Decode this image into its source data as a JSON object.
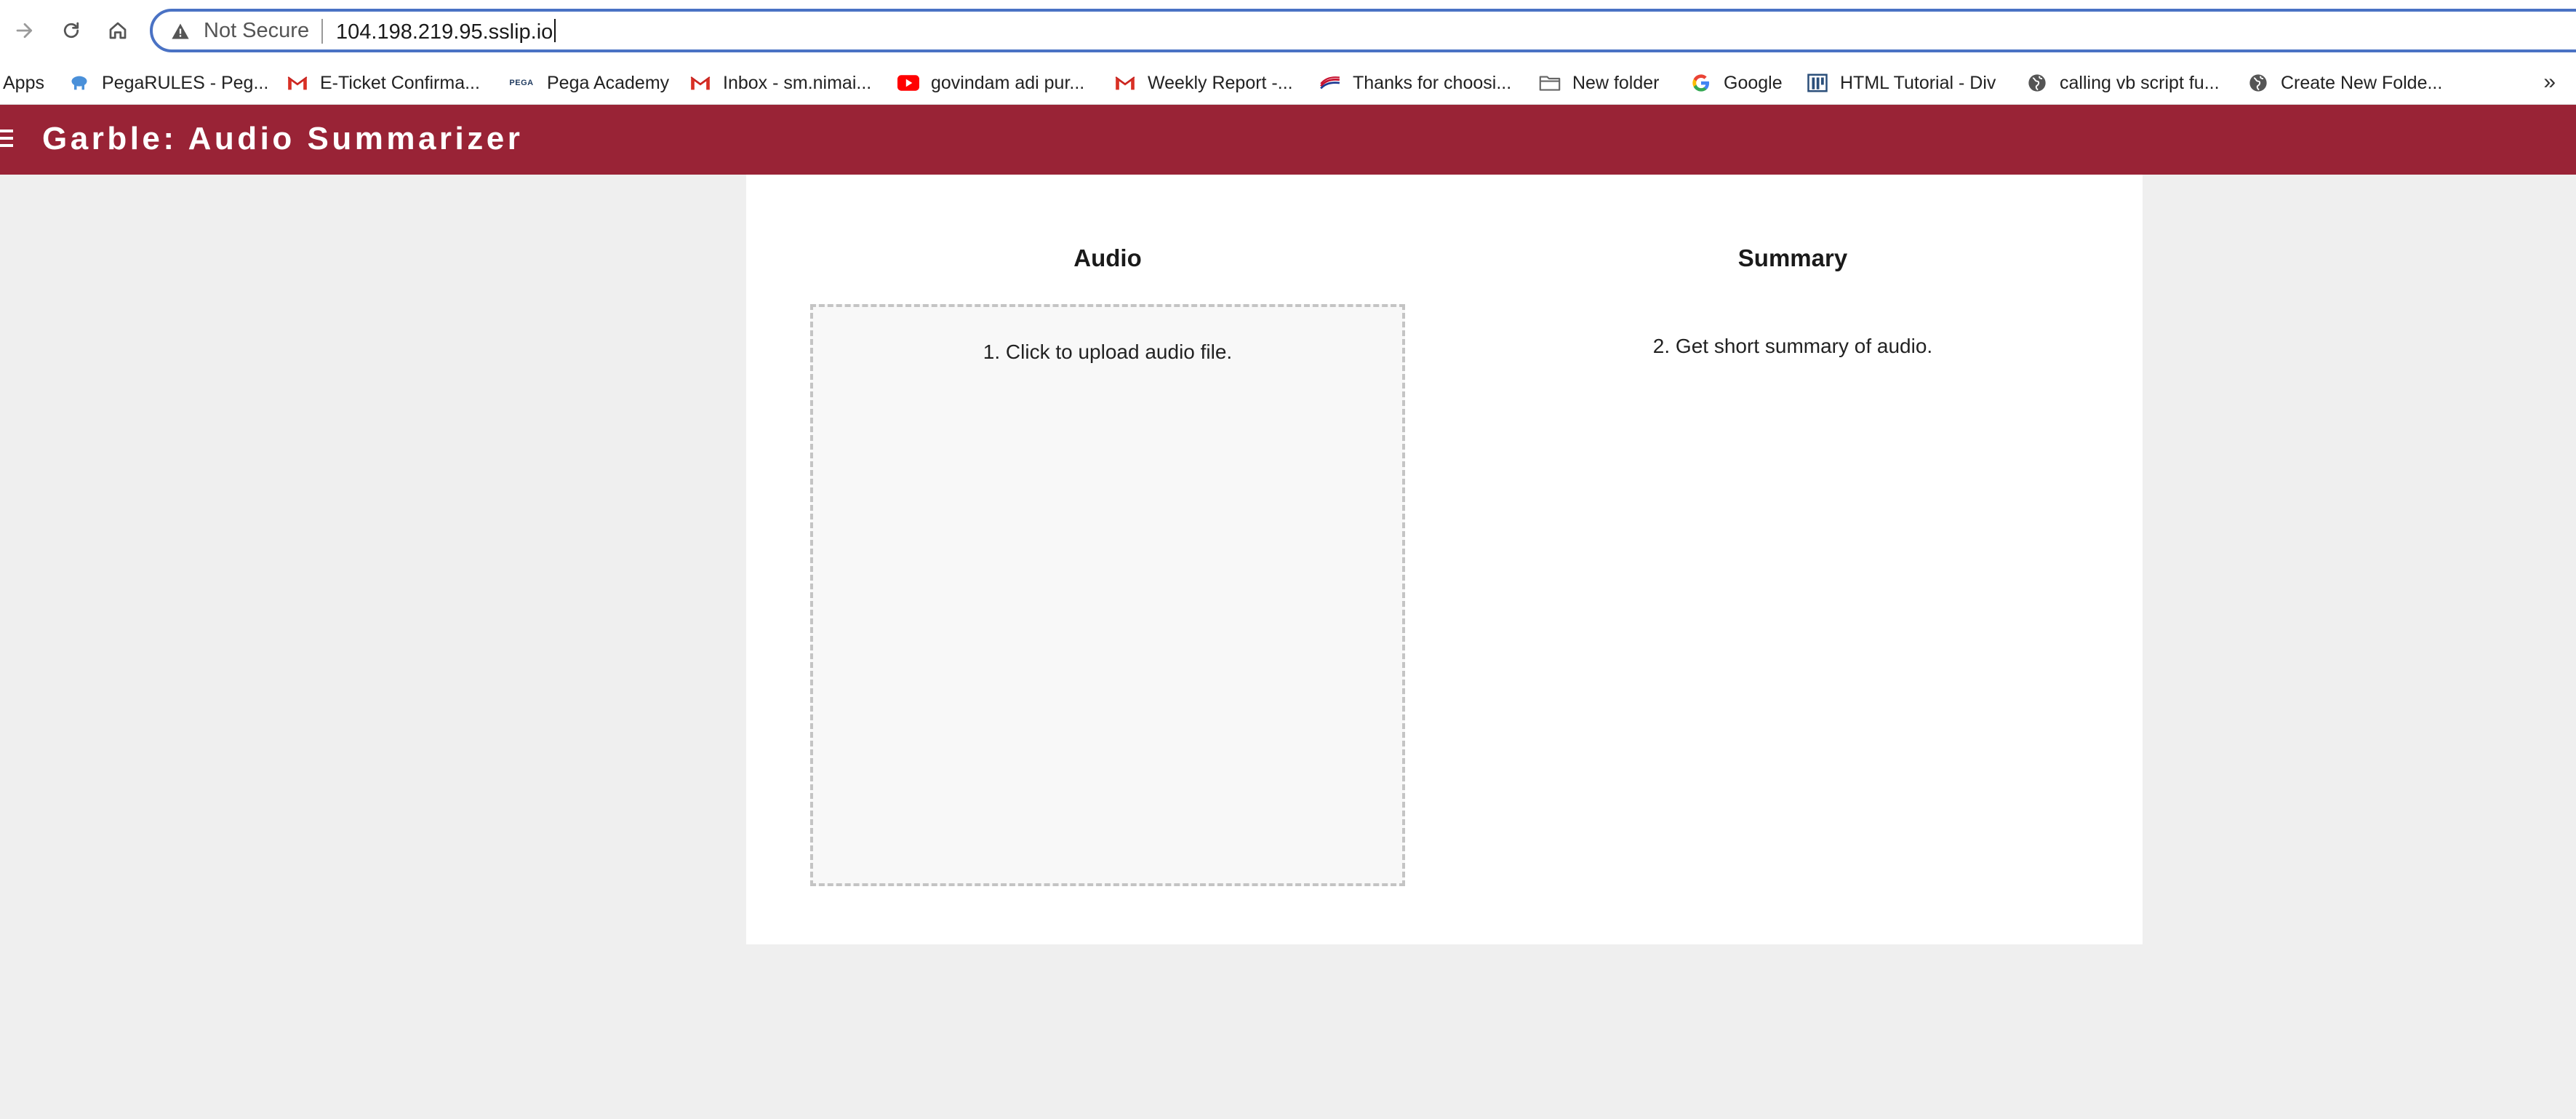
{
  "browser": {
    "security_label": "Not Secure",
    "url": "104.198.219.95.sslip.io"
  },
  "bookmarks": [
    {
      "label": "Apps",
      "icon": "apps-grid-icon"
    },
    {
      "label": "PegaRULES - Peg...",
      "icon": "pega-cloud-icon"
    },
    {
      "label": "E-Ticket Confirma...",
      "icon": "gmail-icon"
    },
    {
      "label": "Pega Academy",
      "icon": "pega-logo-icon",
      "icon_text": "PEGA"
    },
    {
      "label": "Inbox - sm.nimai...",
      "icon": "gmail-icon"
    },
    {
      "label": "govindam adi pur...",
      "icon": "youtube-icon"
    },
    {
      "label": "Weekly Report -...",
      "icon": "gmail-icon"
    },
    {
      "label": "Thanks for choosi...",
      "icon": "flag-stripes-icon"
    },
    {
      "label": "New folder",
      "icon": "folder-icon"
    },
    {
      "label": "Google",
      "icon": "google-icon"
    },
    {
      "label": "HTML Tutorial - Div",
      "icon": "tutorial-site-icon"
    },
    {
      "label": "calling vb script fu...",
      "icon": "globe-icon"
    },
    {
      "label": "Create New Folde...",
      "icon": "globe-icon"
    }
  ],
  "bookmarks_more": "»",
  "app": {
    "title": "Garble: Audio Summarizer",
    "brand_color": "#992336"
  },
  "audio": {
    "heading": "Audio",
    "upload_instruction": "1. Click to upload audio file."
  },
  "summary": {
    "heading": "Summary",
    "instruction": "2. Get short summary of audio."
  }
}
